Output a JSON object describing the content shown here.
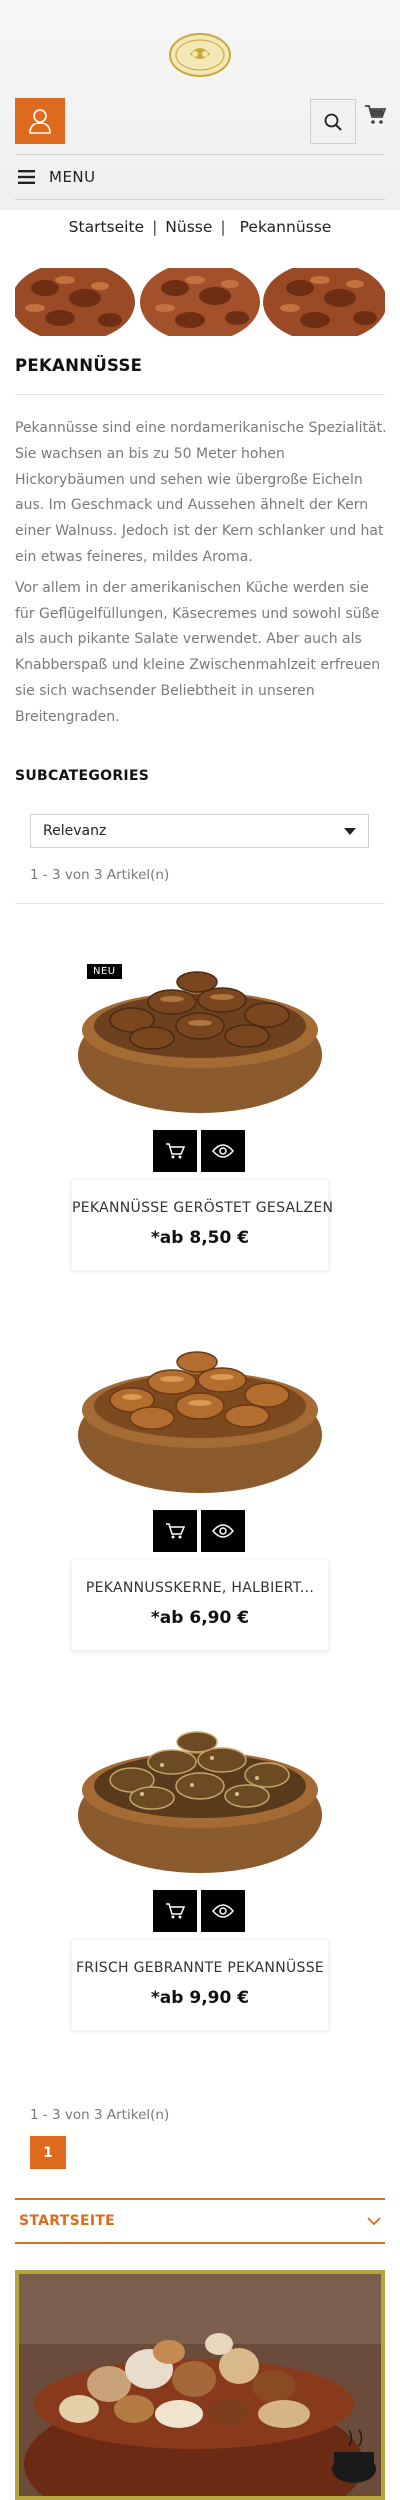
{
  "header": {
    "logo_text_top": "ZO & FREE",
    "logo_text_bottom": "EIDSVERGEN",
    "menu_label": "MENU",
    "icons": [
      "user-icon",
      "search-icon",
      "cart-icon",
      "hamburger-icon"
    ],
    "accent_color": "#dd6a1d"
  },
  "breadcrumb": [
    "Startseite",
    "Nüsse",
    "Pekannüsse"
  ],
  "category": {
    "title": "PEKANNÜSSE",
    "description": [
      "Pekannüsse sind eine nordamerikanische Spezialität. Sie wachsen an bis zu 50 Meter hohen Hickorybäumen und sehen wie übergroße Eicheln aus. Im Geschmack und Aussehen ähnelt der Kern einer Walnuss. Jedoch ist der Kern schlanker und hat ein etwas feineres, mildes Aroma.",
      "Vor allem in der amerikanischen Küche werden sie für Geflügelfüllungen, Käsecremes und sowohl süße als auch pikante Salate verwendet. Aber auch als Knabberspaß und kleine Zwischenmahlzeit erfreuen sie sich wachsender Beliebtheit in unseren Breitengraden."
    ],
    "subcategories_heading": "SUBCATEGORIES"
  },
  "sort": {
    "selected": "Relevanz"
  },
  "count_text": "1 - 3 von 3 Artikel(n)",
  "products": [
    {
      "badge": "NEU",
      "name": "PEKANNÜSSE GERÖSTET GESALZEN",
      "price": "*ab 8,50 €"
    },
    {
      "badge": "",
      "name": "PEKANNUSSKERNE, HALBIERT...",
      "price": "*ab 6,90 €"
    },
    {
      "badge": "",
      "name": "FRISCH GEBRANNTE PEKANNÜSSE",
      "price": "*ab 9,90 €"
    }
  ],
  "pagination": {
    "current": "1"
  },
  "footer": {
    "home_label": "STARTSEITE"
  }
}
